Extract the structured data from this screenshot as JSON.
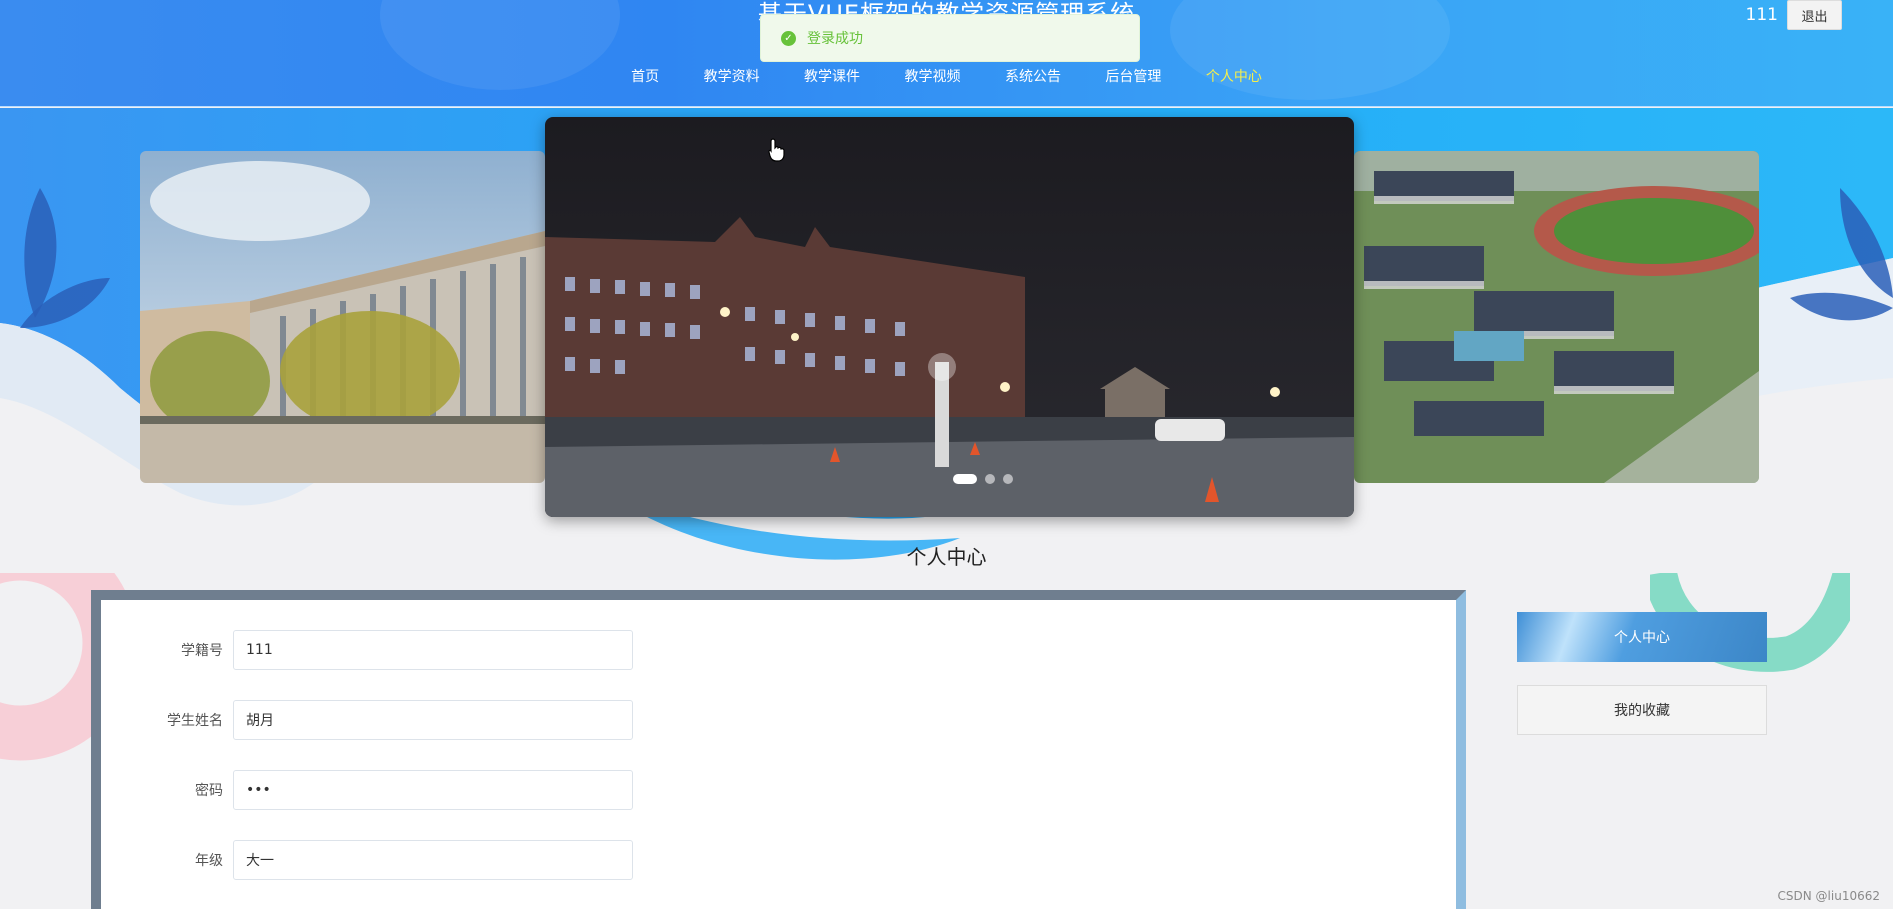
{
  "header": {
    "site_title": "基于VUE框架的教学资源管理系统",
    "nav": [
      "首页",
      "教学资料",
      "教学课件",
      "教学视频",
      "系统公告",
      "后台管理",
      "个人中心"
    ],
    "active_nav": "个人中心",
    "user_name": "111",
    "logout_label": "退出"
  },
  "toast": {
    "message": "登录成功"
  },
  "carousel": {
    "slide_count": 3,
    "active_index": 0
  },
  "section_title": "个人中心",
  "profile_form": {
    "fields": [
      {
        "label": "学籍号",
        "value": "111"
      },
      {
        "label": "学生姓名",
        "value": "胡月"
      },
      {
        "label": "密码",
        "value": "•••"
      },
      {
        "label": "年级",
        "value": "大一"
      }
    ]
  },
  "sidebar": {
    "items": [
      "个人中心",
      "我的收藏"
    ]
  },
  "watermark": "CSDN @liu10662",
  "colors": {
    "accent": "#3a8cf0",
    "active_nav": "#f6ef4a",
    "toast_green": "#67c23a"
  }
}
